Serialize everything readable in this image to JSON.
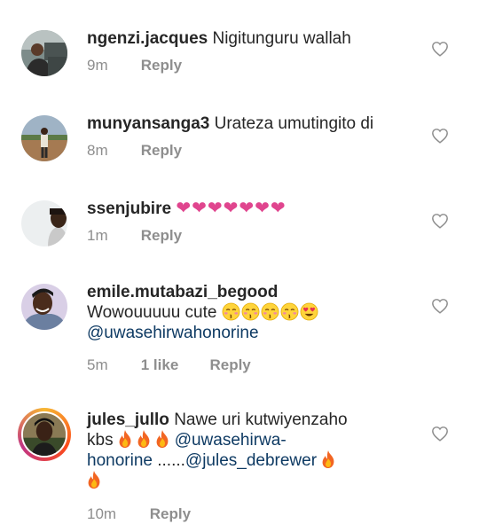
{
  "comments": [
    {
      "username": "ngenzi.jacques",
      "text": "Nigitunguru wallah",
      "age": "9m",
      "reply_label": "Reply"
    },
    {
      "username": "munyansanga3",
      "text": "Urateza umutingito di",
      "age": "8m",
      "reply_label": "Reply"
    },
    {
      "username": "ssenjubire",
      "hearts": "❤❤❤❤❤❤❤",
      "age": "1m",
      "reply_label": "Reply"
    },
    {
      "username": "emile.mutabazi_begood",
      "text": "Wowouuuuu cute",
      "mention": "@uwasehirwahonorine",
      "age": "5m",
      "likes": "1 like",
      "reply_label": "Reply"
    },
    {
      "username": "jules_jullo",
      "text_1": "Nawe uri kutwiyenzaho",
      "text_2": "kbs",
      "mention_1a": "@uwasehirwa-",
      "mention_1b": "honorine",
      "dots": " ......",
      "mention_2": "@jules_debrewer",
      "age": "10m",
      "reply_label": "Reply"
    }
  ],
  "icons": {
    "like": "heart-outline-icon",
    "fire": "fire-emoji",
    "face": "kissing-face-emoji",
    "heart_eyes": "heart-eyes-emoji"
  },
  "colors": {
    "text": "#262626",
    "meta": "#8e8e8e",
    "mention": "#0e3a63",
    "heart": "#e0458e"
  }
}
